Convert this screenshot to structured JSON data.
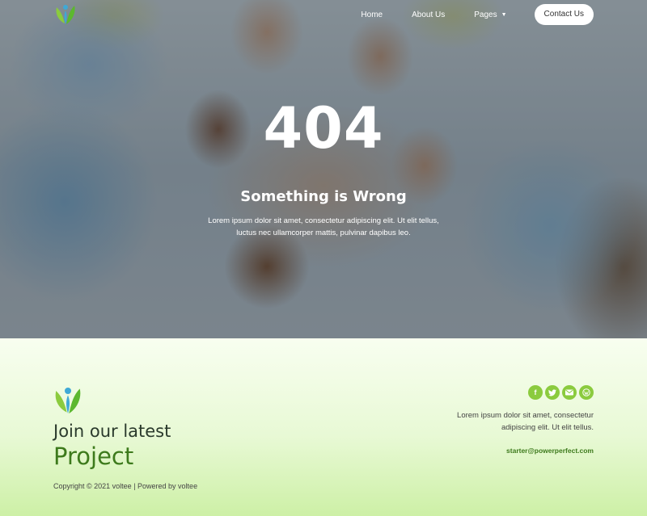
{
  "header": {
    "logo_icon": "leaf-people-logo-icon",
    "nav": [
      {
        "label": "Home"
      },
      {
        "label": "About Us"
      },
      {
        "label": "Pages",
        "icon": "chevron-down-icon"
      }
    ],
    "contact_label": "Contact Us"
  },
  "hero": {
    "code": "404",
    "title": "Something is Wrong",
    "text": "Lorem ipsum dolor sit amet, consectetur adipiscing elit. Ut elit tellus, luctus nec ullamcorper mattis, pulvinar dapibus leo."
  },
  "footer": {
    "logo_icon": "leaf-people-logo-icon",
    "join_label": "Join our latest",
    "project_label": "Project",
    "copyright": "Copyright © 2021 voltee | Powered by voltee",
    "socials": [
      {
        "icon": "facebook-icon"
      },
      {
        "icon": "twitter-icon"
      },
      {
        "icon": "email-icon"
      },
      {
        "icon": "wordpress-icon"
      }
    ],
    "text": "Lorem ipsum dolor sit amet, consectetur adipiscing elit. Ut elit tellus.",
    "email": "starter@powerperfect.com"
  },
  "colors": {
    "accent_green": "#8bcb3e",
    "dark_green": "#3d7a1c",
    "logo_blue": "#3fa9d6"
  }
}
